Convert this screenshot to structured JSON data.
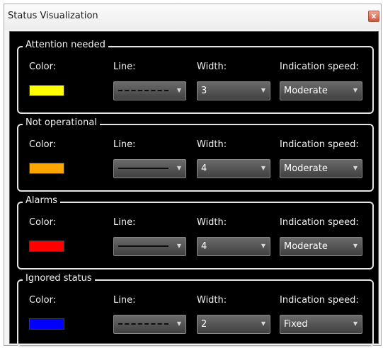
{
  "window": {
    "title": "Status Visualization",
    "close_glyph": "x"
  },
  "column_labels": {
    "color": "Color:",
    "line": "Line:",
    "width": "Width:",
    "speed": "Indication speed:"
  },
  "groups": [
    {
      "name": "Attention needed",
      "color": "#ffff00",
      "line_style": "dashed",
      "width": "3",
      "speed": "Moderate"
    },
    {
      "name": "Not operational",
      "color": "#ffa500",
      "line_style": "solid",
      "width": "4",
      "speed": "Moderate"
    },
    {
      "name": "Alarms",
      "color": "#ff0000",
      "line_style": "solid",
      "width": "4",
      "speed": "Moderate"
    },
    {
      "name": "Ignored status",
      "color": "#0000ff",
      "line_style": "dashed",
      "width": "2",
      "speed": "Fixed"
    }
  ],
  "icons": {
    "dropdown": "chevron-down-icon",
    "close": "close-icon"
  }
}
